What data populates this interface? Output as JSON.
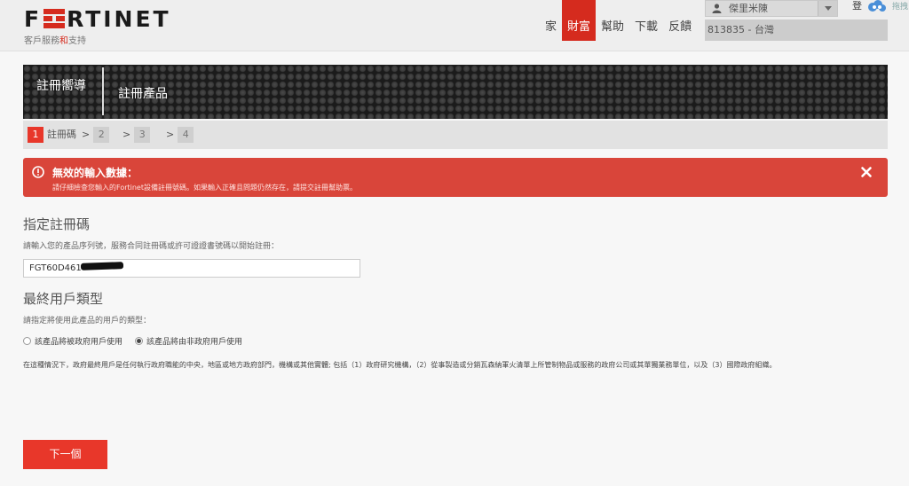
{
  "header": {
    "logo_text": "FORTINET",
    "subtitle_pre": "客戶服務",
    "subtitle_red": "和",
    "subtitle_post": "支持",
    "nav": [
      "家",
      "財富",
      "幫助",
      "下載",
      "反饋"
    ],
    "active_nav": "財富",
    "user_name": "傑里米陳",
    "login": "登",
    "account_location": "813835 - 台灣",
    "extension_label": "拖拽"
  },
  "banner": {
    "title": "註冊嚮導",
    "subtitle": "註冊產品"
  },
  "steps": [
    {
      "num": "1",
      "label": "註冊碼"
    },
    {
      "num": "2",
      "label": ""
    },
    {
      "num": "3",
      "label": ""
    },
    {
      "num": "4",
      "label": ""
    }
  ],
  "step_separator": ">",
  "alert": {
    "title": "無效的輸入數據：",
    "message": "請仔細檢查您輸入的Fortinet設備註冊號碼。如果輸入正確且問題仍然存在，請提交註冊幫助票。"
  },
  "registration": {
    "heading": "指定註冊碼",
    "prompt": "請輸入您的產品序列號，服務合同註冊碼或許可證證書號碼以開始註冊：",
    "value": "FGT60D461"
  },
  "end_user": {
    "heading": "最終用戶類型",
    "prompt": "請指定將使用此產品的用戶的類型：",
    "options": [
      "該產品將被政府用戶使用",
      "該產品將由非政府用戶使用"
    ],
    "selected_index": 1,
    "note": "在這種情況下，政府最終用戶是任何執行政府職能的中央，地區或地方政府部門，機構或其他實體; 包括（1）政府研究機構，（2）從事製造或分銷瓦森納軍火清單上所管制物品或服務的政府公司或其單獨業務單位，以及（3）國際政府組織。"
  },
  "next_button": "下一個",
  "colors": {
    "brand_red": "#d52b1e",
    "alert_red": "#d9453a",
    "button_red": "#e8372a"
  }
}
